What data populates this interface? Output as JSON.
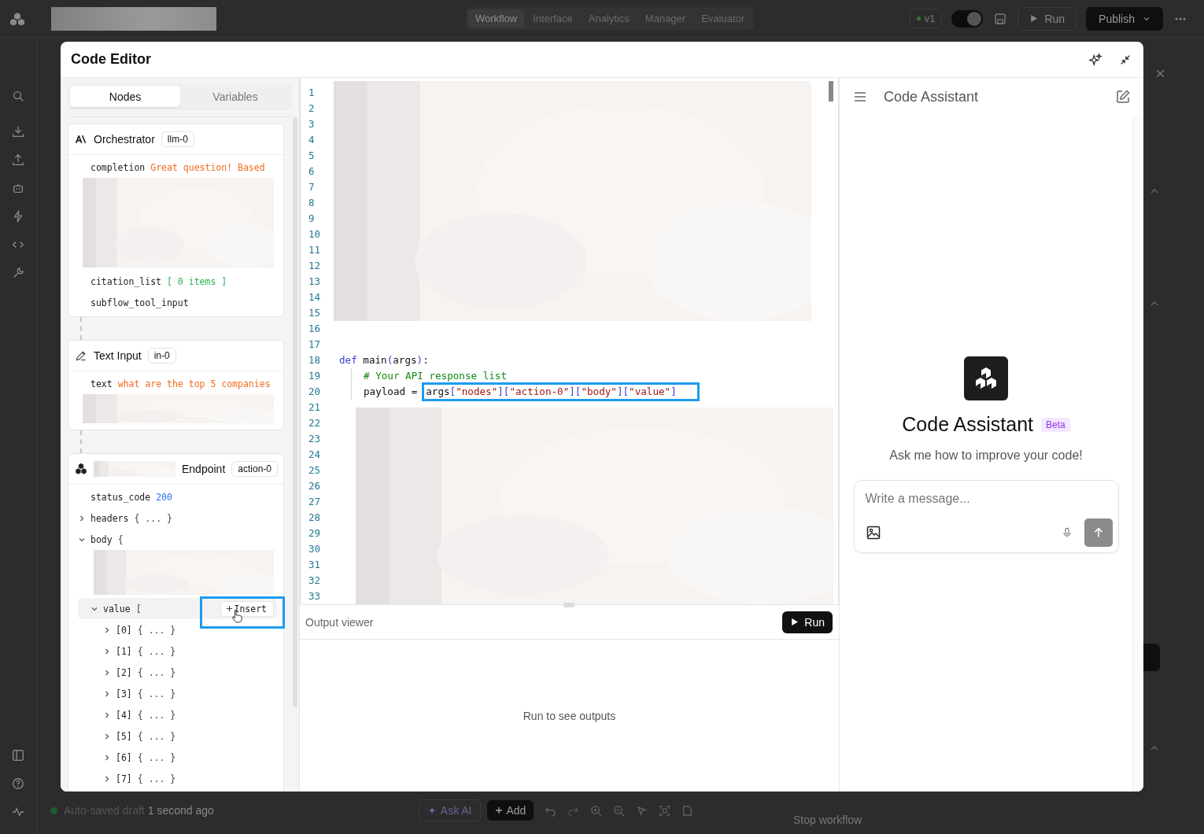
{
  "app": {
    "nav_tabs": [
      {
        "label": "Workflow",
        "selected": true
      },
      {
        "label": "Interface",
        "selected": false
      },
      {
        "label": "Analytics",
        "selected": false
      },
      {
        "label": "Manager",
        "selected": false
      },
      {
        "label": "Evaluator",
        "selected": false
      }
    ],
    "version": "v1",
    "sync_on": true,
    "run": "Run",
    "publish": "Publish",
    "status": "Auto-saved draft",
    "status_time": "1 second ago",
    "ask_ai": "Ask AI",
    "add": "Add",
    "side_card": "Stop workflow"
  },
  "editor": {
    "title": "Code Editor",
    "tabs": [
      {
        "label": "Nodes",
        "selected": true
      },
      {
        "label": "Variables",
        "selected": false
      }
    ],
    "nodes": [
      {
        "kind": "llm",
        "title": "Orchestrator",
        "badge": "llm-0",
        "fields": [
          {
            "key": "completion",
            "color": "#f46a1f",
            "value": "Great question! Based"
          },
          {
            "kind": "picture"
          },
          {
            "key": "citation_list",
            "color": "#2ab34f",
            "value": "[ 0 items ]"
          },
          {
            "key": "subflow_tool_input"
          }
        ]
      },
      {
        "kind": "input",
        "title": "Text Input",
        "badge": "in-0",
        "fields": [
          {
            "key": "text",
            "color": "#f46a1f",
            "value": "what are the top 5 companies"
          },
          {
            "kind": "picture"
          }
        ]
      },
      {
        "kind": "action",
        "title": "Endpoint",
        "badge": "action-0",
        "fields": [
          {
            "key": "status_code",
            "color": "#2f6df6",
            "value": "200"
          },
          {
            "key": "headers",
            "expanded": false,
            "value": "{ ... }"
          },
          {
            "key": "body",
            "expanded": true,
            "value": "{",
            "children": [
              {
                "kind": "picture"
              },
              {
                "key": "value",
                "expanded": true,
                "value": "[",
                "insert": {
                  "label": "Insert",
                  "highlighted": true
                },
                "children": [
                  {
                    "key": "[0]",
                    "expanded": false,
                    "value": "{ ... }"
                  },
                  {
                    "key": "[1]",
                    "expanded": false,
                    "value": "{ ... }"
                  },
                  {
                    "key": "[2]",
                    "expanded": false,
                    "value": "{ ... }"
                  },
                  {
                    "key": "[3]",
                    "expanded": false,
                    "value": "{ ... }"
                  },
                  {
                    "key": "[4]",
                    "expanded": false,
                    "value": "{ ... }"
                  },
                  {
                    "key": "[5]",
                    "expanded": false,
                    "value": "{ ... }"
                  },
                  {
                    "key": "[6]",
                    "expanded": false,
                    "value": "{ ... }"
                  },
                  {
                    "key": "[7]",
                    "expanded": false,
                    "value": "{ ... }"
                  }
                ]
              }
            ]
          }
        ]
      }
    ],
    "line_numbers": [
      "1",
      "2",
      "3",
      "4",
      "5",
      "6",
      "7",
      "8",
      "9",
      "10",
      "11",
      "12",
      "13",
      "14",
      "15",
      "16",
      "17",
      "18",
      "19",
      "20",
      "21",
      "22",
      "23",
      "24",
      "25",
      "26",
      "27",
      "28",
      "29",
      "30",
      "31",
      "32",
      "33"
    ],
    "code": [
      {
        "kind": "picture"
      },
      {
        "kind": "blank"
      },
      {
        "kind": "blank"
      },
      {
        "kind": "code",
        "indented": false,
        "tokens": [
          {
            "kind": "keyword",
            "text": "def"
          },
          {
            "kind": "plain",
            "text": "main"
          },
          {
            "kind": "punct",
            "text": "("
          },
          {
            "kind": "plain",
            "text": "args"
          },
          {
            "kind": "punct",
            "text": ")"
          },
          {
            "kind": "plain",
            "text": ":"
          }
        ]
      },
      {
        "kind": "code",
        "indented": true,
        "tokens": [
          {
            "kind": "comment",
            "text": "# Your API response list"
          }
        ]
      },
      {
        "kind": "code",
        "indented": true,
        "tokens": [
          {
            "kind": "plain",
            "text": "payload ="
          }
        ],
        "highlighted": true,
        "highlight_tokens": [
          {
            "kind": "plain",
            "text": "args"
          },
          {
            "kind": "punct",
            "text": "["
          },
          {
            "kind": "string",
            "text": "\"nodes\""
          },
          {
            "kind": "punct",
            "text": "]["
          },
          {
            "kind": "string",
            "text": "\"action-0\""
          },
          {
            "kind": "punct",
            "text": "]["
          },
          {
            "kind": "string",
            "text": "\"body\""
          },
          {
            "kind": "punct",
            "text": "]["
          },
          {
            "kind": "string",
            "text": "\"value\""
          },
          {
            "kind": "punct",
            "text": "]"
          }
        ]
      },
      {
        "kind": "picture"
      }
    ],
    "output": {
      "title": "Output viewer",
      "run": "Run",
      "empty": "Run to see outputs"
    },
    "assistant": {
      "title": "Code Assistant",
      "hero_title": "Code Assistant",
      "badge": "Beta",
      "subtitle": "Ask me how to improve your code!",
      "placeholder": "Write a message..."
    }
  }
}
